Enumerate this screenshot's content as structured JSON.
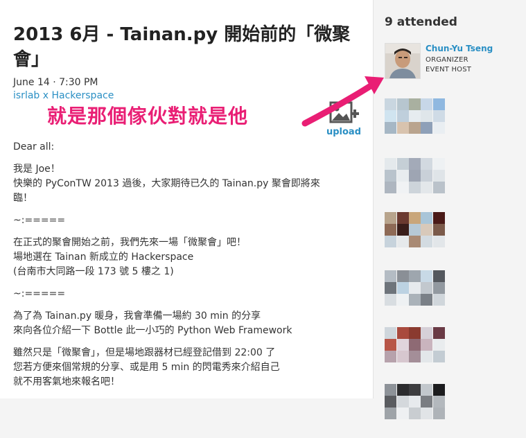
{
  "event": {
    "title": "2013 6月 - Tainan.py 開始前的「微聚會」",
    "date": "June 14 · 7:30 PM",
    "venue": "isrlab x Hackerspace"
  },
  "annotation": {
    "callout": "就是那個傢伙對就是他",
    "accent_color": "#e91e74"
  },
  "upload": {
    "label": "upload",
    "icon": "image-upload-icon"
  },
  "description": {
    "greeting": "Dear all:",
    "para1": [
      "我是 Joe！",
      "快樂的 PyConTW 2013 過後，大家期待已久的 Tainan.py 聚會即將來",
      "臨！"
    ],
    "sep1": "~:=====",
    "para2": [
      "在正式的聚會開始之前，我們先來一場「微聚會」吧！",
      "場地選在 Tainan 新成立的 Hackerspace",
      "(台南市大同路一段 173 號 5 樓之 1)"
    ],
    "sep2": "~:=====",
    "para3": [
      "為了為 Tainan.py 暖身，我會準備一場約 30 min 的分享",
      "來向各位介紹一下 Bottle 此一小巧的 Python Web Framework"
    ],
    "para4": [
      "雖然只是「微聚會」，但是場地跟器材已經登記借到 22:00 了",
      "您若方便來個常規的分享、或是用 5 min 的閃電秀來介紹自己",
      "就不用客氣地來報名吧！"
    ]
  },
  "sidebar": {
    "attended_count_label": "9 attended",
    "organizer": {
      "name": "Chun-Yu Tseng",
      "role1": "ORGANIZER",
      "role2": "EVENT HOST"
    }
  },
  "colors": {
    "link": "#2a8fc4",
    "text": "#333333"
  }
}
